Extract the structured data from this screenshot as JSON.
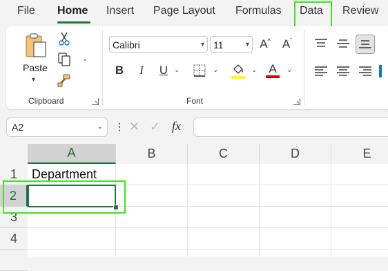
{
  "tabs": [
    "File",
    "Home",
    "Insert",
    "Page Layout",
    "Formulas",
    "Data",
    "Review"
  ],
  "active_tab": "Home",
  "clipboard": {
    "paste_label": "Paste",
    "group_label": "Clipboard"
  },
  "font": {
    "font_name": "Calibri",
    "font_size": "11",
    "group_label": "Font",
    "bold": "B",
    "italic": "I",
    "underline": "U",
    "grow": "A",
    "shrink": "A",
    "font_color": "A",
    "highlight_color": "#ffff00",
    "font_color_hex": "#e00000"
  },
  "formula_bar": {
    "name_box": "A2",
    "fx": "fx",
    "value": ""
  },
  "sheet": {
    "columns": [
      "A",
      "B",
      "C",
      "D",
      "E"
    ],
    "rows": [
      "1",
      "2",
      "3",
      "4"
    ],
    "cells": {
      "A1": "Department",
      "A2": ""
    },
    "active_cell": "A2"
  },
  "colors": {
    "accent": "#217346",
    "annotation": "#3de51e"
  }
}
